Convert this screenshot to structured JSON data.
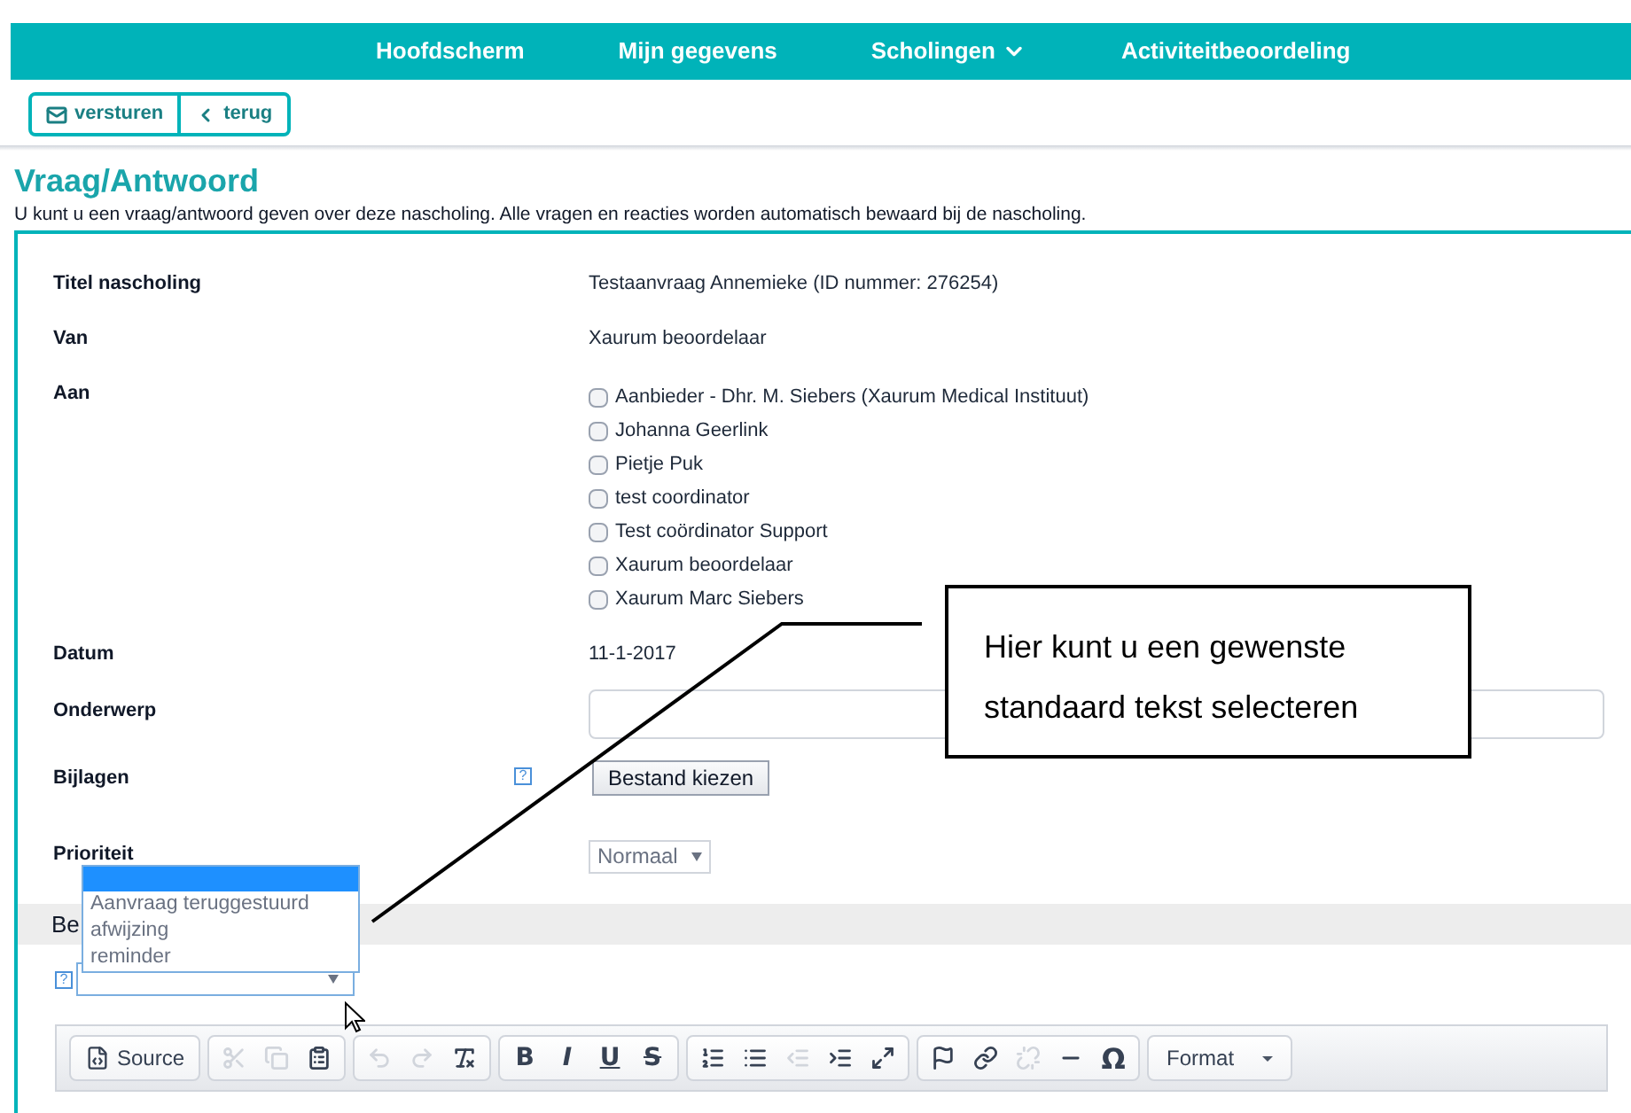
{
  "nav": [
    {
      "label": "Hoofdscherm",
      "has_menu": false
    },
    {
      "label": "Mijn gegevens",
      "has_menu": false
    },
    {
      "label": "Scholingen",
      "has_menu": true
    },
    {
      "label": "Activiteitbeoordeling",
      "has_menu": false
    }
  ],
  "actions": [
    {
      "kind": "send",
      "label": "versturen"
    },
    {
      "kind": "back",
      "label": "terug"
    }
  ],
  "title": "Vraag/Antwoord",
  "intro": "U kunt u een vraag/antwoord geven over deze nascholing. Alle vragen en reacties worden automatisch bewaard bij de nascholing.",
  "form": {
    "titel": {
      "label": "Titel nascholing",
      "value": "Testaanvraag Annemieke (ID nummer: 276254)"
    },
    "van": {
      "label": "Van",
      "value": "Xaurum beoordelaar"
    },
    "aan": {
      "label": "Aan",
      "recipients": [
        {
          "name": "Aanbieder - Dhr. M. Siebers (Xaurum Medical Instituut)",
          "checked": false
        },
        {
          "name": "Johanna Geerlink",
          "checked": false
        },
        {
          "name": "Pietje Puk",
          "checked": false
        },
        {
          "name": "test coordinator",
          "checked": false
        },
        {
          "name": "Test coördinator Support",
          "checked": false
        },
        {
          "name": "Xaurum beoordelaar",
          "checked": false
        },
        {
          "name": "Xaurum Marc Siebers",
          "checked": false
        }
      ]
    },
    "datum": {
      "label": "Datum",
      "value": "11-1-2017"
    },
    "onderwerp": {
      "label": "Onderwerp"
    },
    "bijlagen": {
      "label": "Bijlagen",
      "help": "?",
      "button": "Bestand kiezen"
    },
    "prioriteit": {
      "label": "Prioriteit",
      "value": "Normaal"
    }
  },
  "section_heading": "Be",
  "template_select": {
    "help": "?",
    "blank_highlighted": true,
    "options": [
      "Aanvraag teruggestuurd",
      "afwijzing",
      "reminder"
    ]
  },
  "toolbar": [
    [
      {
        "kind": "source",
        "label": "Source",
        "disabled": false
      }
    ],
    [
      {
        "kind": "cut",
        "disabled": true
      },
      {
        "kind": "copy",
        "disabled": true
      },
      {
        "kind": "paste",
        "disabled": false
      }
    ],
    [
      {
        "kind": "undo",
        "disabled": true
      },
      {
        "kind": "redo",
        "disabled": true
      },
      {
        "kind": "clear-format",
        "disabled": false
      }
    ],
    [
      {
        "kind": "bold",
        "label": "B",
        "disabled": false
      },
      {
        "kind": "italic",
        "label": "I",
        "disabled": false
      },
      {
        "kind": "underline",
        "label": "U",
        "disabled": false
      },
      {
        "kind": "strike",
        "label": "S",
        "disabled": false
      }
    ],
    [
      {
        "kind": "numbered-list",
        "disabled": false
      },
      {
        "kind": "bullet-list",
        "disabled": false
      },
      {
        "kind": "outdent",
        "disabled": true
      },
      {
        "kind": "indent",
        "disabled": false
      },
      {
        "kind": "maximize",
        "disabled": false
      }
    ],
    [
      {
        "kind": "anchor",
        "disabled": false
      },
      {
        "kind": "link",
        "disabled": false
      },
      {
        "kind": "unlink",
        "disabled": true
      },
      {
        "kind": "rule",
        "disabled": false
      },
      {
        "kind": "special-char",
        "label": "Ω",
        "disabled": false
      }
    ],
    [
      {
        "kind": "format",
        "label": "Format",
        "disabled": false
      }
    ]
  ],
  "callout": "Hier kunt u een gewenste standaard tekst selecteren"
}
